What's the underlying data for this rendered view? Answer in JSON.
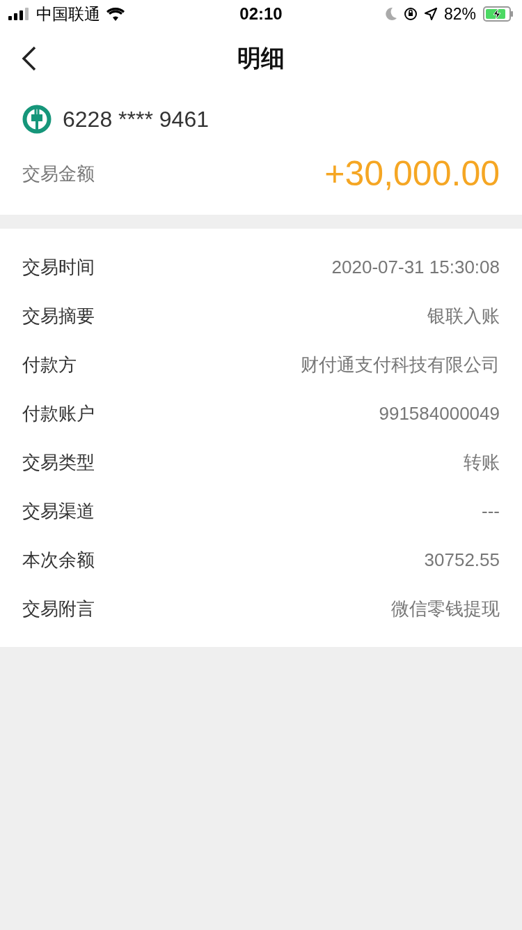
{
  "status_bar": {
    "carrier": "中国联通",
    "time": "02:10",
    "battery": "82%"
  },
  "nav": {
    "title": "明细"
  },
  "account": {
    "card_number": "6228 **** 9461",
    "amount_label": "交易金额",
    "amount": "+30,000.00"
  },
  "details": [
    {
      "label": "交易时间",
      "value": "2020-07-31 15:30:08"
    },
    {
      "label": "交易摘要",
      "value": "银联入账"
    },
    {
      "label": "付款方",
      "value": "财付通支付科技有限公司"
    },
    {
      "label": "付款账户",
      "value": "991584000049"
    },
    {
      "label": "交易类型",
      "value": "转账"
    },
    {
      "label": "交易渠道",
      "value": "---"
    },
    {
      "label": "本次余额",
      "value": "30752.55"
    },
    {
      "label": "交易附言",
      "value": "微信零钱提现"
    }
  ]
}
